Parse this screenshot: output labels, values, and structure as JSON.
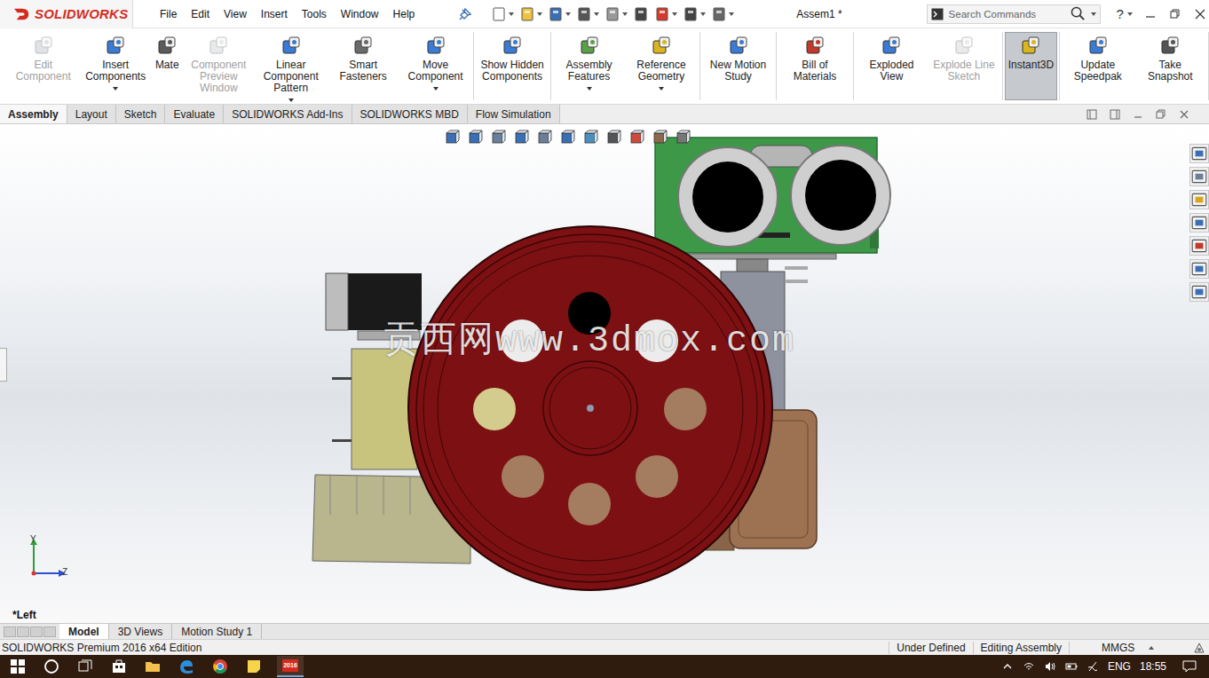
{
  "app": {
    "logo": "SOLIDWORKS",
    "title": "Assem1 *"
  },
  "menu": [
    "File",
    "Edit",
    "View",
    "Insert",
    "Tools",
    "Window",
    "Help"
  ],
  "search": {
    "placeholder": "Search Commands"
  },
  "help": "?",
  "ribbon": [
    [
      {
        "label": "Edit Component",
        "disabled": true,
        "selected": false,
        "dropdown": false
      },
      {
        "label": "Insert Components",
        "disabled": false,
        "selected": false,
        "dropdown": true
      },
      {
        "label": "Mate",
        "disabled": false,
        "selected": false,
        "dropdown": false
      },
      {
        "label": "Component Preview Window",
        "disabled": true,
        "selected": false,
        "dropdown": false
      },
      {
        "label": "Linear Component Pattern",
        "disabled": false,
        "selected": false,
        "dropdown": true
      },
      {
        "label": "Smart Fasteners",
        "disabled": false,
        "selected": false,
        "dropdown": false
      },
      {
        "label": "Move Component",
        "disabled": false,
        "selected": false,
        "dropdown": true
      }
    ],
    [
      {
        "label": "Show Hidden Components",
        "disabled": false,
        "selected": false,
        "dropdown": false
      }
    ],
    [
      {
        "label": "Assembly Features",
        "disabled": false,
        "selected": false,
        "dropdown": true
      },
      {
        "label": "Reference Geometry",
        "disabled": false,
        "selected": false,
        "dropdown": true
      }
    ],
    [
      {
        "label": "New Motion Study",
        "disabled": false,
        "selected": false,
        "dropdown": false
      }
    ],
    [
      {
        "label": "Bill of Materials",
        "disabled": false,
        "selected": false,
        "dropdown": false
      }
    ],
    [
      {
        "label": "Exploded View",
        "disabled": false,
        "selected": false,
        "dropdown": false
      },
      {
        "label": "Explode Line Sketch",
        "disabled": true,
        "selected": false,
        "dropdown": false
      }
    ],
    [
      {
        "label": "Instant3D",
        "disabled": false,
        "selected": true,
        "dropdown": false
      }
    ],
    [
      {
        "label": "Update Speedpak",
        "disabled": false,
        "selected": false,
        "dropdown": false
      },
      {
        "label": "Take Snapshot",
        "disabled": false,
        "selected": false,
        "dropdown": false
      }
    ]
  ],
  "tabs": [
    {
      "label": "Assembly",
      "selected": true
    },
    {
      "label": "Layout",
      "selected": false
    },
    {
      "label": "Sketch",
      "selected": false
    },
    {
      "label": "Evaluate",
      "selected": false
    },
    {
      "label": "SOLIDWORKS Add-Ins",
      "selected": false
    },
    {
      "label": "SOLIDWORKS MBD",
      "selected": false
    },
    {
      "label": "Flow Simulation",
      "selected": false
    }
  ],
  "viewport": {
    "view_name": "*Left",
    "axis_y": "Y",
    "axis_z": "Z",
    "watermark": "贡西网www.3dmox.com"
  },
  "bottom_tabs": [
    {
      "label": "Model",
      "selected": true
    },
    {
      "label": "3D Views",
      "selected": false
    },
    {
      "label": "Motion Study 1",
      "selected": false
    }
  ],
  "status_bar": {
    "product": "SOLIDWORKS Premium 2016 x64 Edition",
    "items": [
      "Under Defined",
      "Editing Assembly"
    ],
    "units": "MMGS"
  },
  "taskbar": {
    "app_badge": "2016",
    "language": "ENG",
    "time": "18:55"
  }
}
